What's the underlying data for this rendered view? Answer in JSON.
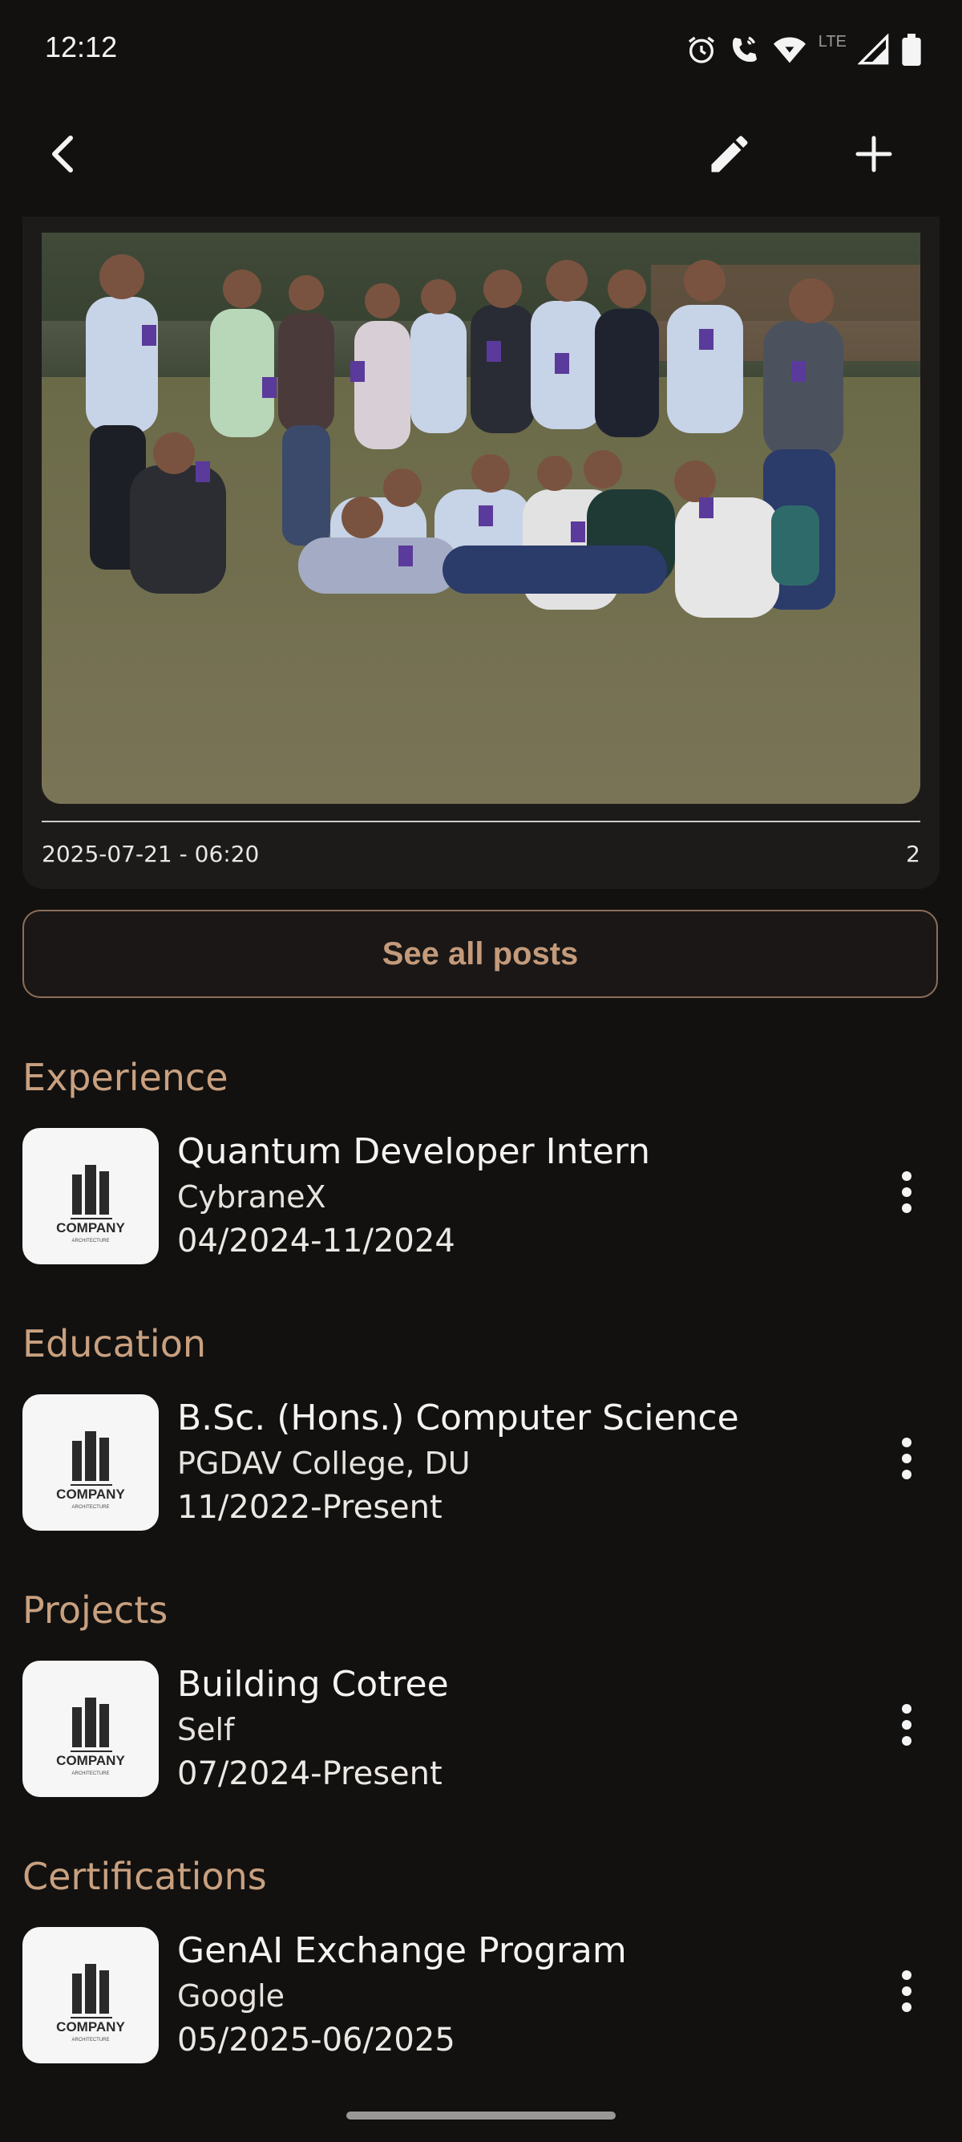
{
  "status_bar": {
    "time": "12:12",
    "network_label": "LTE",
    "icons": [
      "alarm-icon",
      "wifi-calling-icon",
      "wifi-icon",
      "signal-icon",
      "battery-icon"
    ]
  },
  "toolbar": {
    "icons": [
      "back-icon",
      "edit-icon",
      "add-icon"
    ]
  },
  "post": {
    "date": "2025-07-21 - 06:20",
    "count": "2"
  },
  "see_all_label": "See all posts",
  "logo_text": {
    "line1": "COMPANY",
    "line2": "ARCHITECTURE"
  },
  "sections": {
    "experience": {
      "title": "Experience",
      "item": {
        "title": "Quantum Developer Intern",
        "subtitle": "CybraneX",
        "dates": "04/2024-11/2024"
      }
    },
    "education": {
      "title": "Education",
      "item": {
        "title": "B.Sc. (Hons.) Computer Science",
        "subtitle": "PGDAV College, DU",
        "dates": "11/2022-Present"
      }
    },
    "projects": {
      "title": "Projects",
      "item": {
        "title": "Building Cotree",
        "subtitle": "Self",
        "dates": "07/2024-Present"
      }
    },
    "certifications": {
      "title": "Certifications",
      "item": {
        "title": "GenAI Exchange Program",
        "subtitle": "Google",
        "dates": "05/2025-06/2025"
      }
    }
  },
  "colors": {
    "background": "#121110",
    "accent": "#c9a07f",
    "button_border": "#8e6e58",
    "card": "#1d1b1a"
  }
}
